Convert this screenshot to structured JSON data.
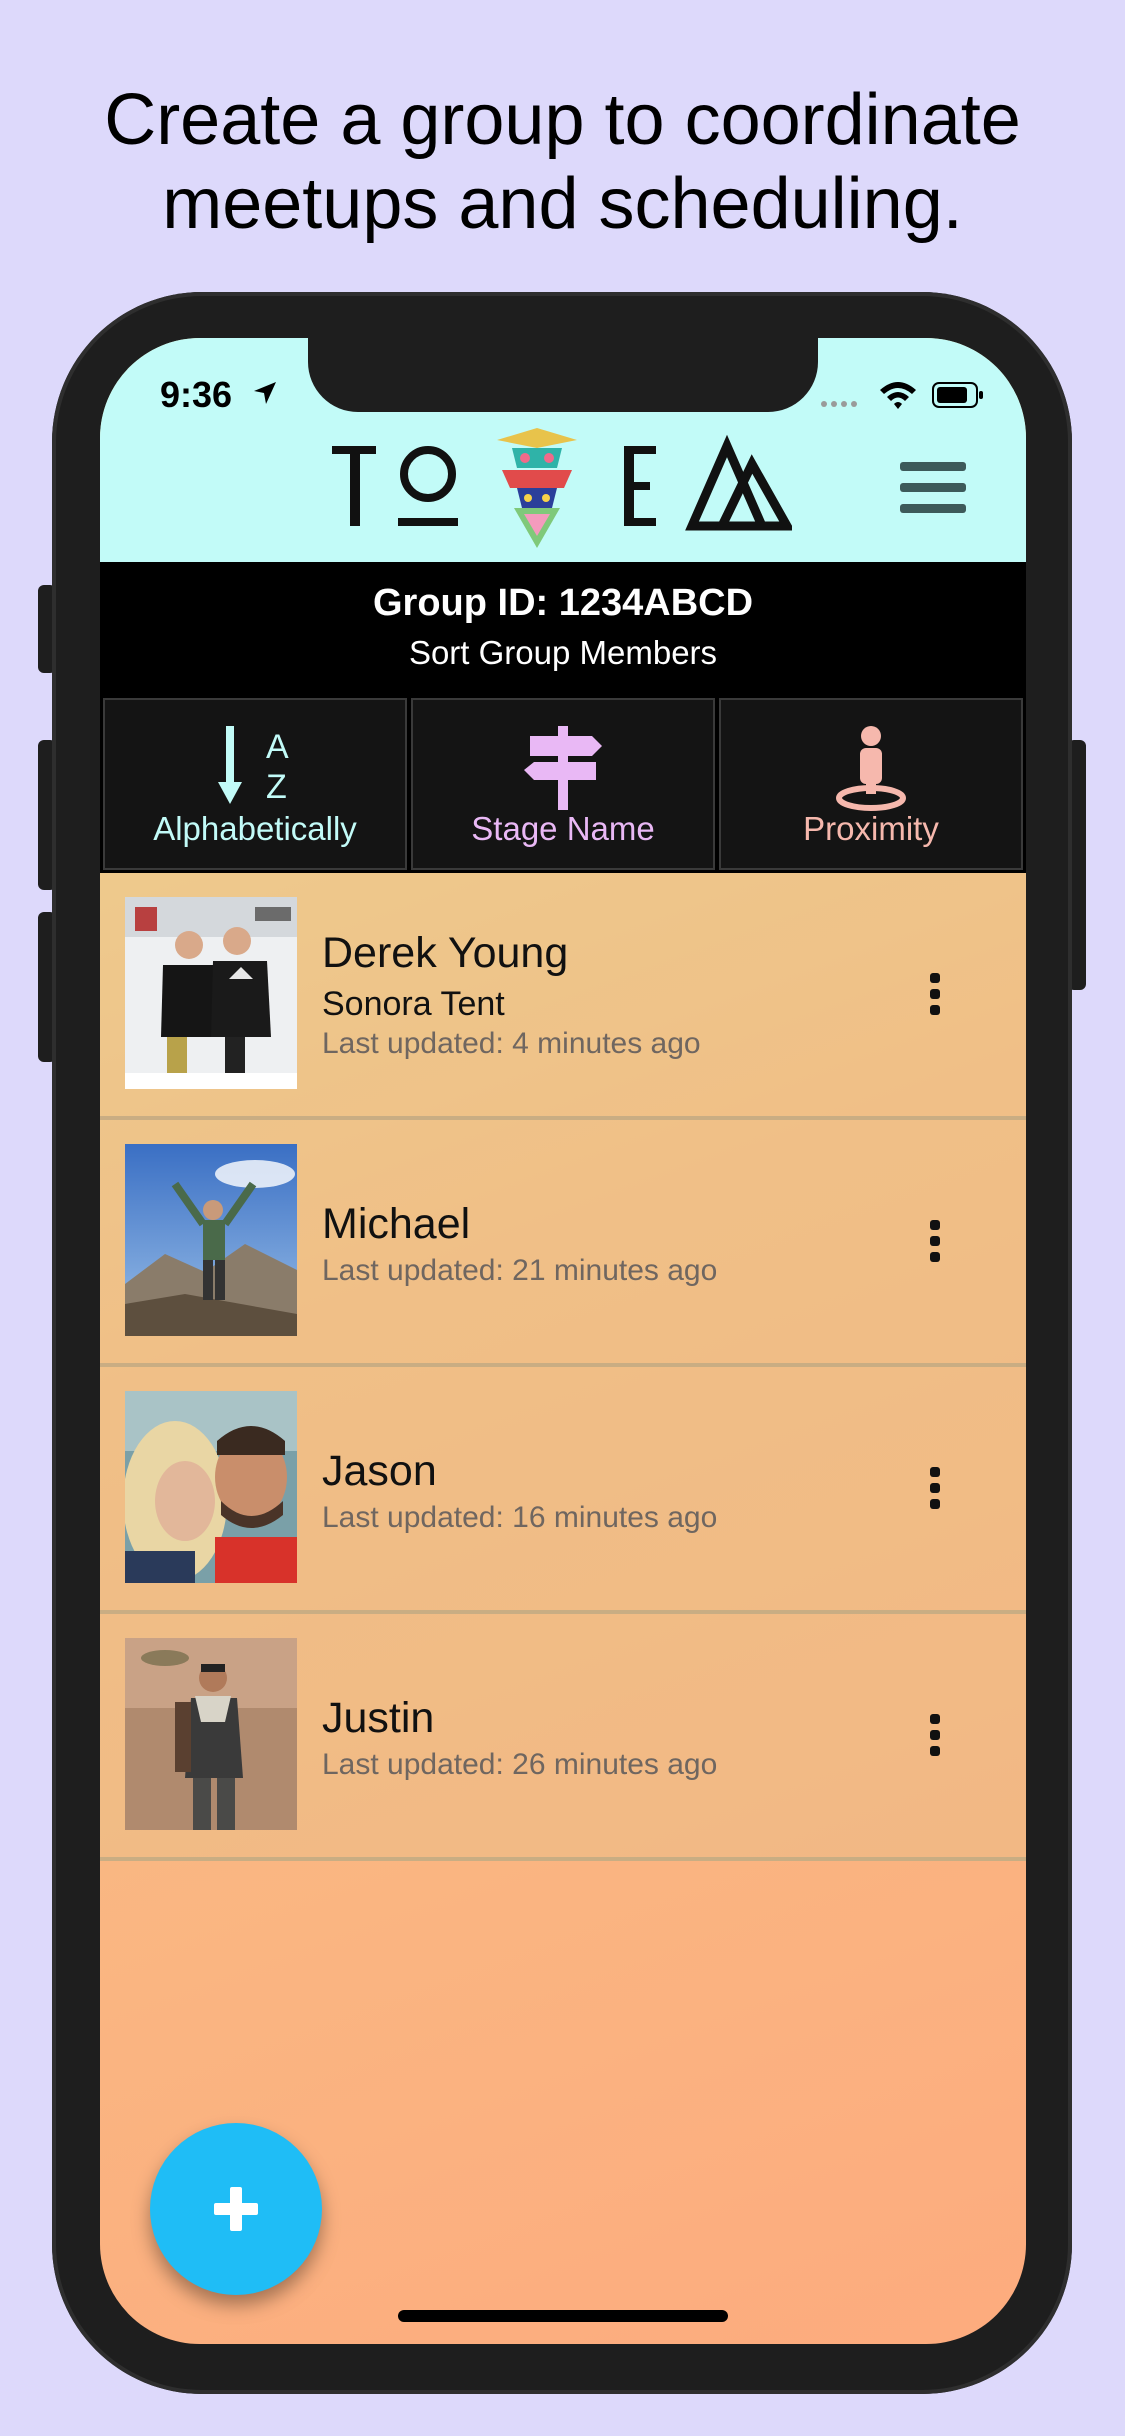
{
  "headline": {
    "line1": "Create a group to coordinate",
    "line2": "meetups and scheduling."
  },
  "status_bar": {
    "time": "9:36",
    "icons": [
      "location-arrow-icon",
      "signal-icon",
      "wifi-icon",
      "battery-icon"
    ]
  },
  "header": {
    "logo_text": "TOTEM",
    "menu_icon": "hamburger-menu-icon",
    "background": "#c2fbf8"
  },
  "group": {
    "id_label": "Group ID: 1234ABCD",
    "sort_label": "Sort Group Members"
  },
  "sort_options": [
    {
      "label": "Alphabetically",
      "icon": "sort-alpha-icon",
      "color": "#c2fbf8"
    },
    {
      "label": "Stage Name",
      "icon": "signpost-icon",
      "color": "#e9b8f5"
    },
    {
      "label": "Proximity",
      "icon": "person-location-icon",
      "color": "#f6b8ad"
    }
  ],
  "members": [
    {
      "name": "Derek Young",
      "stage_name": "Sonora Tent",
      "updated": "Last updated: 4 minutes ago"
    },
    {
      "name": "Michael",
      "updated": "Last updated: 21 minutes ago"
    },
    {
      "name": "Jason",
      "updated": "Last updated: 16 minutes ago"
    },
    {
      "name": "Justin",
      "updated": "Last updated: 26 minutes ago"
    }
  ],
  "fab": {
    "icon": "plus-icon",
    "color": "#1fbdf6"
  }
}
